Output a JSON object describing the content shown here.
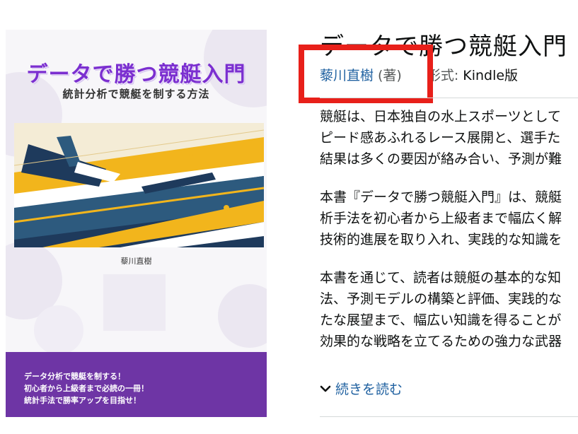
{
  "cover": {
    "title": "データで勝つ競艇入門",
    "subtitle": "統計分析で競艇を制する方法",
    "author": "藜川直樹",
    "banner_lines": [
      "データ分析で競艇を制する！",
      "初心者から上級者まで必読の一冊！",
      "統計手法で勝率アップを目指せ！"
    ]
  },
  "product": {
    "title": "データで勝つ競艇入門",
    "author": "藜川直樹",
    "author_role": "(著)",
    "format_label": "形式:",
    "format_value": "Kindle版"
  },
  "description": {
    "paragraphs": [
      [
        "競艇は、日本独自の水上スポーツとして",
        "ピード感あふれるレース展開と、選手た",
        "結果は多くの要因が絡み合い、予測が難"
      ],
      [
        "本書『データで勝つ競艇入門』は、競艇",
        "析手法を初心者から上級者まで幅広く解",
        "技術的進展を取り入れ、実践的な知識を"
      ],
      [
        "本書を通じて、読者は競艇の基本的な知",
        "法、予測モデルの構築と評価、実践的な",
        "たな展望まで、幅広い知識を得ることが",
        "効果的な戦略を立てるための強力な武器"
      ]
    ],
    "read_more": "続きを読む"
  },
  "colors": {
    "link": "#2162a1",
    "highlight": "#e8201a",
    "cover_title": "#7b2fd0",
    "cover_banner": "#6e35a5"
  }
}
